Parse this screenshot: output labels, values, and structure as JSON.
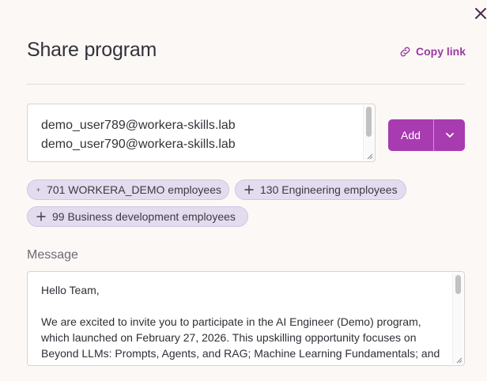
{
  "dialog": {
    "title": "Share program",
    "copy_link_label": "Copy link",
    "close_icon": "close-icon"
  },
  "recipients": {
    "value": "demo_user789@workera-skills.lab\ndemo_user790@workera-skills.lab",
    "lines": [
      "demo_user789@workera-skills.lab",
      "demo_user790@workera-skills.lab"
    ]
  },
  "add": {
    "label": "Add",
    "dropdown_icon": "chevron-down-icon"
  },
  "suggestions": [
    {
      "label": "701 WORKERA_DEMO employees",
      "icon": "plus-icon"
    },
    {
      "label": "130 Engineering employees",
      "icon": "plus-icon"
    },
    {
      "label": "99 Business development employees",
      "icon": "plus-icon"
    }
  ],
  "message": {
    "label": "Message",
    "greeting": "Hello Team,",
    "body": "We are excited to invite you to participate in the AI Engineer (Demo) program, which launched on February 27, 2026. This upskilling opportunity focuses on Beyond LLMs: Prompts, Agents, and RAG; Machine Learning Fundamentals; and Data Science Programming, designed to help you build practical skills and knowledge."
  },
  "colors": {
    "accent": "#a83bb0",
    "link": "#9a3aa3",
    "chip_bg": "#e3dcef",
    "background": "#fcf8f6"
  }
}
